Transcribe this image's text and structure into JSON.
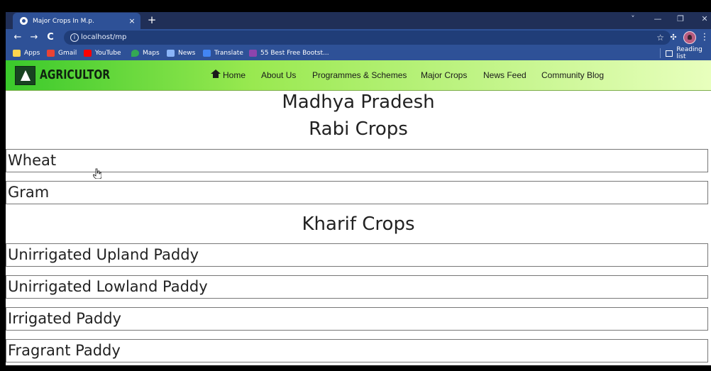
{
  "browser": {
    "tab_title": "Major Crops In M.p.",
    "close_tab": "×",
    "new_tab": "+",
    "window_controls": [
      "˅",
      "—",
      "❐",
      "✕"
    ],
    "nav_buttons": [
      "←",
      "→",
      "C"
    ],
    "url": "localhost/mp",
    "info_symbol": "i",
    "bookmark_star": "☆",
    "menu_symbol": "⋮",
    "bookmarks": [
      {
        "label": "Apps",
        "color": "#ffd54f"
      },
      {
        "label": "Gmail",
        "color": "#ea4335"
      },
      {
        "label": "YouTube",
        "color": "#ff0000"
      },
      {
        "label": "Maps",
        "color": "#34a853"
      },
      {
        "label": "News",
        "color": "#8ab4f8"
      },
      {
        "label": "Translate",
        "color": "#4285f4"
      },
      {
        "label": "55 Best Free Bootst...",
        "color": "#8e44ad"
      }
    ],
    "reading_list": "Reading list"
  },
  "site": {
    "brand": "AGRICULTOR",
    "nav": [
      "Home",
      "About Us",
      "Programmes & Schemes",
      "Major Crops",
      "News Feed",
      "Community Blog"
    ],
    "state_heading": "Madhya Pradesh",
    "rabi_heading": "Rabi Crops",
    "rabi_crops": [
      "Wheat",
      "Gram"
    ],
    "kharif_heading": "Kharif Crops",
    "kharif_crops": [
      "Unirrigated Upland Paddy",
      "Unirrigated Lowland Paddy",
      "Irrigated Paddy",
      "Fragrant Paddy"
    ]
  },
  "colors": {
    "browser_blue": "#2e5197",
    "header_gradient_start": "#3ac92b",
    "header_gradient_end": "#e8ffbd"
  }
}
